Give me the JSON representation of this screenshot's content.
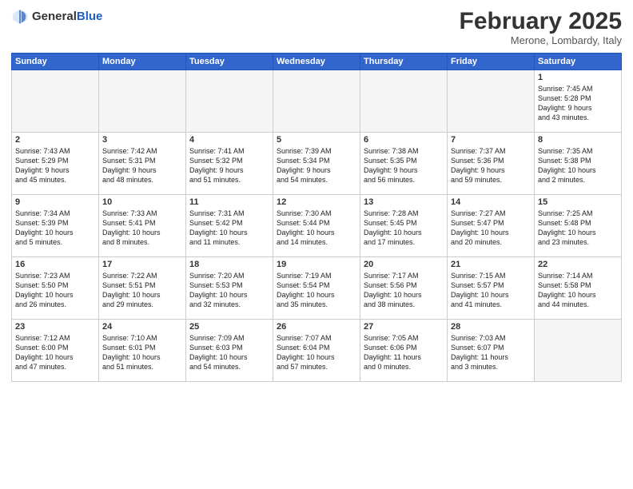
{
  "header": {
    "logo": {
      "general": "General",
      "blue": "Blue"
    },
    "title": "February 2025",
    "location": "Merone, Lombardy, Italy"
  },
  "weekdays": [
    "Sunday",
    "Monday",
    "Tuesday",
    "Wednesday",
    "Thursday",
    "Friday",
    "Saturday"
  ],
  "weeks": [
    [
      {
        "day": null,
        "info": null
      },
      {
        "day": null,
        "info": null
      },
      {
        "day": null,
        "info": null
      },
      {
        "day": null,
        "info": null
      },
      {
        "day": null,
        "info": null
      },
      {
        "day": null,
        "info": null
      },
      {
        "day": "1",
        "info": "Sunrise: 7:45 AM\nSunset: 5:28 PM\nDaylight: 9 hours\nand 43 minutes."
      }
    ],
    [
      {
        "day": "2",
        "info": "Sunrise: 7:43 AM\nSunset: 5:29 PM\nDaylight: 9 hours\nand 45 minutes."
      },
      {
        "day": "3",
        "info": "Sunrise: 7:42 AM\nSunset: 5:31 PM\nDaylight: 9 hours\nand 48 minutes."
      },
      {
        "day": "4",
        "info": "Sunrise: 7:41 AM\nSunset: 5:32 PM\nDaylight: 9 hours\nand 51 minutes."
      },
      {
        "day": "5",
        "info": "Sunrise: 7:39 AM\nSunset: 5:34 PM\nDaylight: 9 hours\nand 54 minutes."
      },
      {
        "day": "6",
        "info": "Sunrise: 7:38 AM\nSunset: 5:35 PM\nDaylight: 9 hours\nand 56 minutes."
      },
      {
        "day": "7",
        "info": "Sunrise: 7:37 AM\nSunset: 5:36 PM\nDaylight: 9 hours\nand 59 minutes."
      },
      {
        "day": "8",
        "info": "Sunrise: 7:35 AM\nSunset: 5:38 PM\nDaylight: 10 hours\nand 2 minutes."
      }
    ],
    [
      {
        "day": "9",
        "info": "Sunrise: 7:34 AM\nSunset: 5:39 PM\nDaylight: 10 hours\nand 5 minutes."
      },
      {
        "day": "10",
        "info": "Sunrise: 7:33 AM\nSunset: 5:41 PM\nDaylight: 10 hours\nand 8 minutes."
      },
      {
        "day": "11",
        "info": "Sunrise: 7:31 AM\nSunset: 5:42 PM\nDaylight: 10 hours\nand 11 minutes."
      },
      {
        "day": "12",
        "info": "Sunrise: 7:30 AM\nSunset: 5:44 PM\nDaylight: 10 hours\nand 14 minutes."
      },
      {
        "day": "13",
        "info": "Sunrise: 7:28 AM\nSunset: 5:45 PM\nDaylight: 10 hours\nand 17 minutes."
      },
      {
        "day": "14",
        "info": "Sunrise: 7:27 AM\nSunset: 5:47 PM\nDaylight: 10 hours\nand 20 minutes."
      },
      {
        "day": "15",
        "info": "Sunrise: 7:25 AM\nSunset: 5:48 PM\nDaylight: 10 hours\nand 23 minutes."
      }
    ],
    [
      {
        "day": "16",
        "info": "Sunrise: 7:23 AM\nSunset: 5:50 PM\nDaylight: 10 hours\nand 26 minutes."
      },
      {
        "day": "17",
        "info": "Sunrise: 7:22 AM\nSunset: 5:51 PM\nDaylight: 10 hours\nand 29 minutes."
      },
      {
        "day": "18",
        "info": "Sunrise: 7:20 AM\nSunset: 5:53 PM\nDaylight: 10 hours\nand 32 minutes."
      },
      {
        "day": "19",
        "info": "Sunrise: 7:19 AM\nSunset: 5:54 PM\nDaylight: 10 hours\nand 35 minutes."
      },
      {
        "day": "20",
        "info": "Sunrise: 7:17 AM\nSunset: 5:56 PM\nDaylight: 10 hours\nand 38 minutes."
      },
      {
        "day": "21",
        "info": "Sunrise: 7:15 AM\nSunset: 5:57 PM\nDaylight: 10 hours\nand 41 minutes."
      },
      {
        "day": "22",
        "info": "Sunrise: 7:14 AM\nSunset: 5:58 PM\nDaylight: 10 hours\nand 44 minutes."
      }
    ],
    [
      {
        "day": "23",
        "info": "Sunrise: 7:12 AM\nSunset: 6:00 PM\nDaylight: 10 hours\nand 47 minutes."
      },
      {
        "day": "24",
        "info": "Sunrise: 7:10 AM\nSunset: 6:01 PM\nDaylight: 10 hours\nand 51 minutes."
      },
      {
        "day": "25",
        "info": "Sunrise: 7:09 AM\nSunset: 6:03 PM\nDaylight: 10 hours\nand 54 minutes."
      },
      {
        "day": "26",
        "info": "Sunrise: 7:07 AM\nSunset: 6:04 PM\nDaylight: 10 hours\nand 57 minutes."
      },
      {
        "day": "27",
        "info": "Sunrise: 7:05 AM\nSunset: 6:06 PM\nDaylight: 11 hours\nand 0 minutes."
      },
      {
        "day": "28",
        "info": "Sunrise: 7:03 AM\nSunset: 6:07 PM\nDaylight: 11 hours\nand 3 minutes."
      },
      {
        "day": null,
        "info": null
      }
    ]
  ]
}
